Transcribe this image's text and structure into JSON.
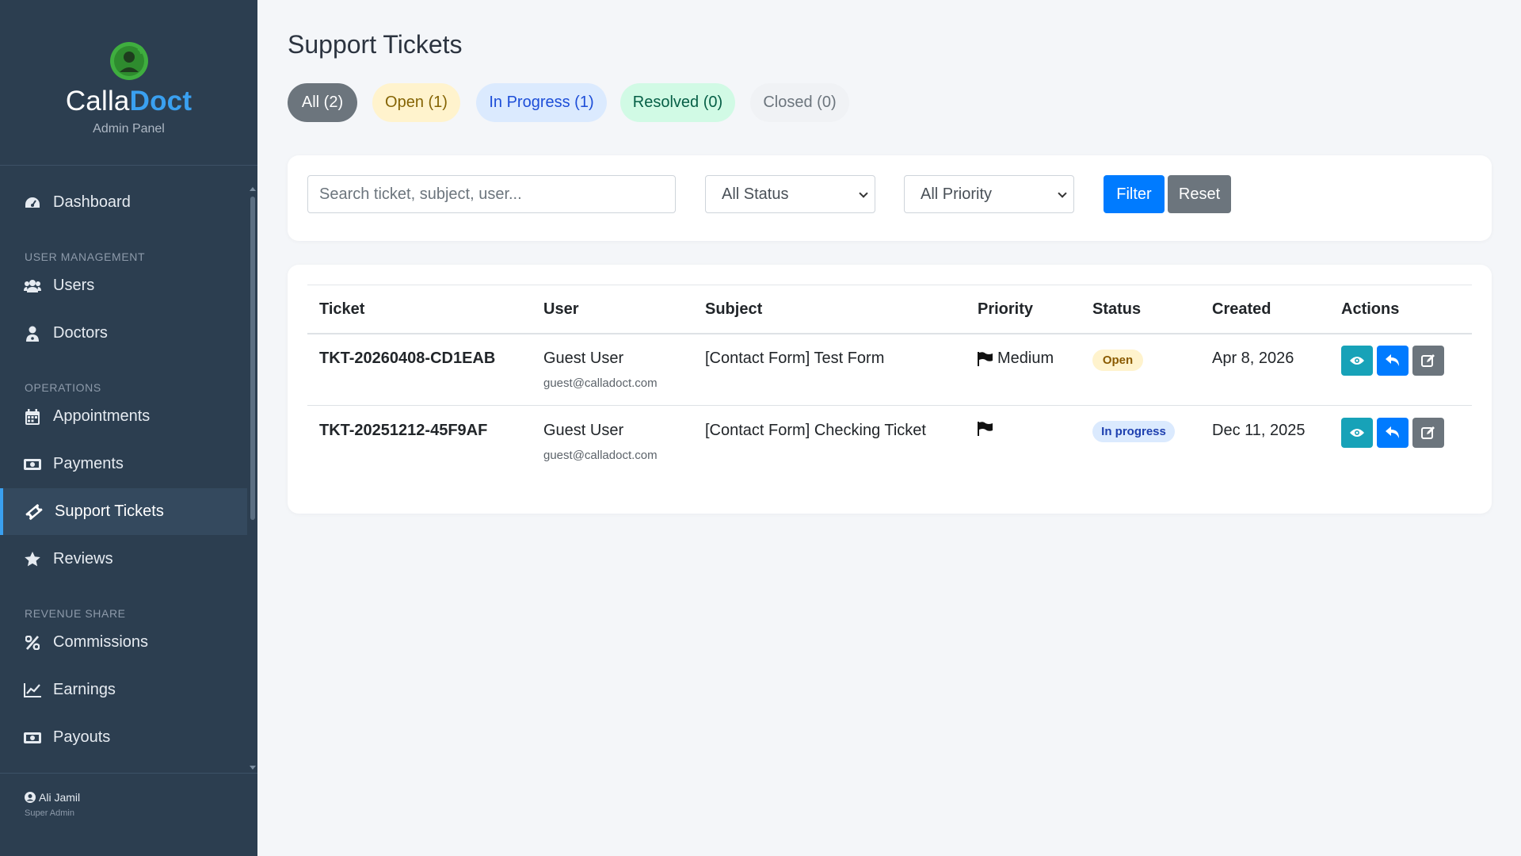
{
  "sidebar": {
    "brand": {
      "part1": "Calla",
      "part2": "Doct",
      "subtitle": "Admin Panel"
    },
    "items": [
      {
        "label": "Dashboard",
        "icon": "tachometer-icon"
      },
      {
        "label": "Users",
        "icon": "users-icon"
      },
      {
        "label": "Doctors",
        "icon": "user-doctor-icon"
      },
      {
        "label": "Appointments",
        "icon": "calendar-icon"
      },
      {
        "label": "Payments",
        "icon": "money-bill-icon"
      },
      {
        "label": "Support Tickets",
        "icon": "ticket-icon",
        "active": true
      },
      {
        "label": "Reviews",
        "icon": "star-icon"
      },
      {
        "label": "Commissions",
        "icon": "percent-icon"
      },
      {
        "label": "Earnings",
        "icon": "chart-line-icon"
      },
      {
        "label": "Payouts",
        "icon": "money-bill-icon"
      }
    ],
    "sections": [
      "USER MANAGEMENT",
      "OPERATIONS",
      "REVENUE SHARE"
    ],
    "footer": {
      "user": "Ali Jamil",
      "role": "Super Admin"
    }
  },
  "page": {
    "title": "Support Tickets"
  },
  "tabs": [
    {
      "label": "All (2)",
      "active": true
    },
    {
      "label": "Open (1)"
    },
    {
      "label": "In Progress (1)"
    },
    {
      "label": "Resolved (0)"
    },
    {
      "label": "Closed (0)"
    }
  ],
  "filters": {
    "search_placeholder": "Search ticket, subject, user...",
    "status_selected": "All Status",
    "priority_selected": "All Priority",
    "filter_label": "Filter",
    "reset_label": "Reset"
  },
  "table": {
    "headers": [
      "Ticket",
      "User",
      "Subject",
      "Priority",
      "Status",
      "Created",
      "Actions"
    ],
    "rows": [
      {
        "ticket": "TKT-20260408-CD1EAB",
        "user_name": "Guest User",
        "user_email": "guest@calladoct.com",
        "subject": "[Contact Form] Test Form",
        "priority": "Medium",
        "status": "Open",
        "created": "Apr 8, 2026"
      },
      {
        "ticket": "TKT-20251212-45F9AF",
        "user_name": "Guest User",
        "user_email": "guest@calladoct.com",
        "subject": "[Contact Form] Checking Ticket",
        "priority": "",
        "status": "In progress",
        "created": "Dec 11, 2025"
      }
    ]
  },
  "colors": {
    "sidebar_bg": "#2c3e50",
    "accent": "#3aa0f0",
    "primary": "#007bff",
    "info": "#17a2b8",
    "secondary": "#6c757d"
  }
}
